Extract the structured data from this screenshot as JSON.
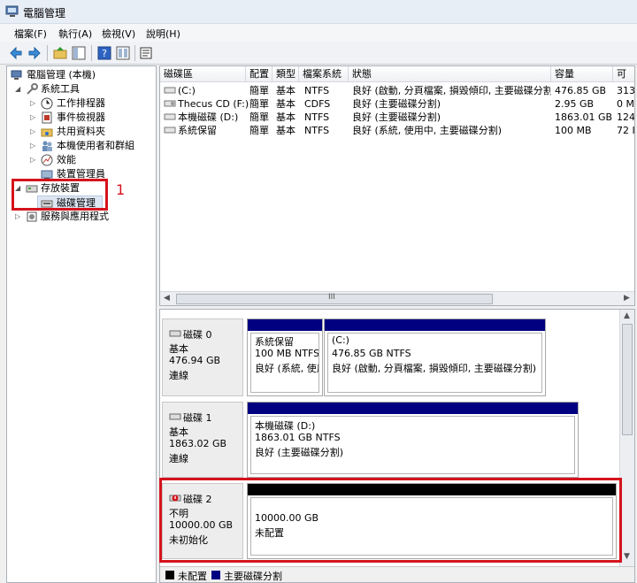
{
  "window": {
    "title": "電腦管理"
  },
  "menu": [
    "檔案(F)",
    "執行(A)",
    "檢視(V)",
    "說明(H)"
  ],
  "tree": {
    "root": "電腦管理 (本機)",
    "system_tools": "系統工具",
    "task_scheduler": "工作排程器",
    "event_viewer": "事件檢視器",
    "shared_folders": "共用資料夾",
    "local_users": "本機使用者和群組",
    "performance": "效能",
    "device_manager": "裝置管理員",
    "storage": "存放裝置",
    "disk_management": "磁碟管理",
    "services": "服務與應用程式"
  },
  "annotation": "1",
  "columns": [
    "磁碟區",
    "配置",
    "類型",
    "檔案系統",
    "狀態",
    "容量",
    "可"
  ],
  "volumes": [
    [
      "(C:)",
      "簡單",
      "基本",
      "NTFS",
      "良好 (啟動, 分頁檔案, 損毀傾印, 主要磁碟分割)",
      "476.85 GB",
      "313"
    ],
    [
      "Thecus CD (F:)",
      "簡單",
      "基本",
      "CDFS",
      "良好 (主要磁碟分割)",
      "2.95 GB",
      "0 M"
    ],
    [
      "本機磁碟 (D:)",
      "簡單",
      "基本",
      "NTFS",
      "良好 (主要磁碟分割)",
      "1863.01 GB",
      "124"
    ],
    [
      "系統保留",
      "簡單",
      "基本",
      "NTFS",
      "良好 (系統, 使用中, 主要磁碟分割)",
      "100 MB",
      "72 I"
    ]
  ],
  "scroll_glyph": "III",
  "disks": [
    {
      "name": "磁碟 0",
      "type": "基本",
      "size": "476.94 GB",
      "status": "連線",
      "partitions": [
        {
          "title": "系統保留",
          "size": "100 MB NTFS",
          "status": "良好 (系統, 使用"
        },
        {
          "title": "(C:)",
          "size": "476.85 GB NTFS",
          "status": "良好 (啟動, 分頁檔案, 損毀傾印, 主要磁碟分割)"
        }
      ]
    },
    {
      "name": "磁碟 1",
      "type": "基本",
      "size": "1863.02 GB",
      "status": "連線",
      "partitions": [
        {
          "title": "本機磁碟  (D:)",
          "size": "1863.01 GB NTFS",
          "status": "良好 (主要磁碟分割)"
        }
      ]
    },
    {
      "name": "磁碟 2",
      "type": "不明",
      "size": "10000.00 GB",
      "status": "未初始化",
      "partitions": [
        {
          "size": "10000.00 GB",
          "status": "未配置"
        }
      ]
    }
  ],
  "legend": {
    "unallocated": "未配置",
    "primary": "主要磁碟分割"
  },
  "colors": {
    "primary_bar": "#000080",
    "unallocated_bar": "#000000",
    "highlight": "#d5131d"
  }
}
